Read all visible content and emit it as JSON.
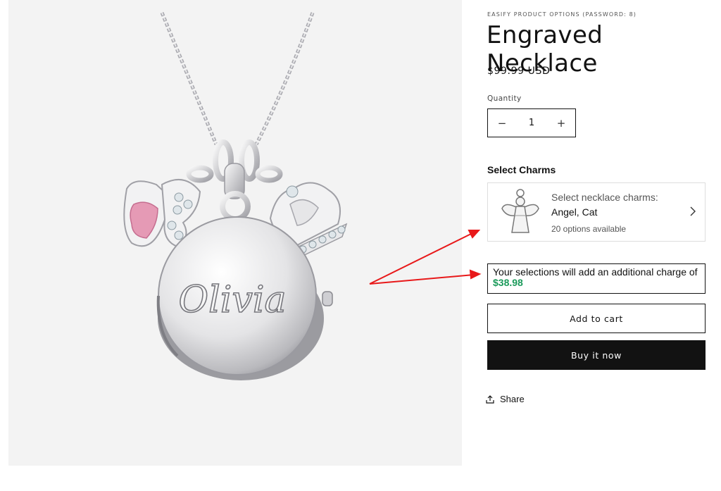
{
  "product": {
    "vendor": "EASIFY PRODUCT OPTIONS (PASSWORD: 8)",
    "title": "Engraved Necklace",
    "price": "$99.99 USD",
    "image_engraving": "Olivia"
  },
  "quantity": {
    "label": "Quantity",
    "value": "1",
    "decrease_symbol": "−",
    "increase_symbol": "+"
  },
  "charms": {
    "heading": "Select Charms",
    "prompt": "Select necklace charms:",
    "selected": "Angel, Cat",
    "options_count": "20 options available"
  },
  "notice": {
    "text": "Your selections will add an additional charge of ",
    "amount": "$38.98",
    "amount_color": "#1a9a5a"
  },
  "buttons": {
    "add_to_cart": "Add to cart",
    "buy_now": "Buy it now"
  },
  "share": {
    "label": "Share",
    "icon": "share-icon"
  },
  "annotation": {
    "arrow_color": "#e8191a"
  }
}
